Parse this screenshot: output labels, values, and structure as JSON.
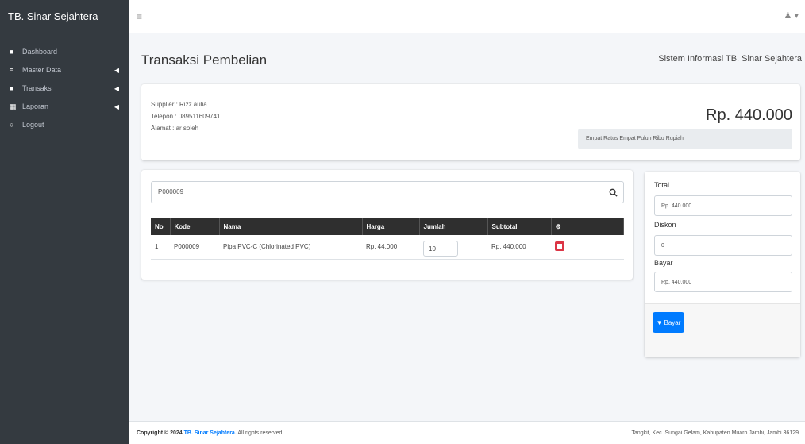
{
  "sidebar": {
    "brand": "TB. Sinar Sejahtera",
    "items": [
      {
        "icon": "dashboard-icon",
        "glyph": "■",
        "label": "Dashboard",
        "has_arrow": false
      },
      {
        "icon": "database-icon",
        "glyph": "≡",
        "label": "Master Data",
        "has_arrow": true
      },
      {
        "icon": "transaction-icon",
        "glyph": "■",
        "label": "Transaksi",
        "has_arrow": true
      },
      {
        "icon": "report-icon",
        "glyph": "▦",
        "label": "Laporan",
        "has_arrow": true
      },
      {
        "icon": "logout-icon",
        "glyph": "○",
        "label": "Logout",
        "has_arrow": false
      }
    ]
  },
  "topbar": {
    "menu_icon": "≡",
    "user_icon": "♟ ▾"
  },
  "header": {
    "title": "Transaksi Pembelian",
    "site_name": "Sistem Informasi TB. Sinar Sejahtera"
  },
  "info": {
    "supplier": "Supplier : Rizz aulia",
    "telepon": "Telepon : 089511609741",
    "alamat": "Alamat : ar soleh",
    "total": "Rp. 440.000",
    "terbilang": "Empat Ratus Empat Puluh Ribu Rupiah"
  },
  "search": {
    "value": "P000009",
    "icon": "search-icon"
  },
  "table": {
    "headers": [
      "No",
      "Kode",
      "Nama",
      "Harga",
      "Jumlah",
      "Subtotal",
      "⚙"
    ],
    "rows": [
      {
        "no": "1",
        "kode": "P000009",
        "nama": "Pipa PVC-C (Chlorinated PVC)",
        "harga": "Rp. 44.000",
        "jumlah": "10",
        "subtotal": "Rp. 440.000"
      }
    ]
  },
  "payment": {
    "total_label": "Total",
    "total_value": "Rp. 440.000",
    "diskon_label": "Diskon",
    "diskon_value": "0",
    "bayar_label": "Bayar",
    "bayar_value": "Rp. 440.000",
    "button_label": "Bayar",
    "button_icon": "🛒"
  },
  "footer": {
    "copyright_prefix": "Copyright © 2024",
    "copyright_link": "TB. Sinar Sejahtera.",
    "copyright_suffix": "All rights reserved.",
    "address": "Tangkit, Kec. Sungai Gelam, Kabupaten Muaro Jambi, Jambi 36129"
  }
}
